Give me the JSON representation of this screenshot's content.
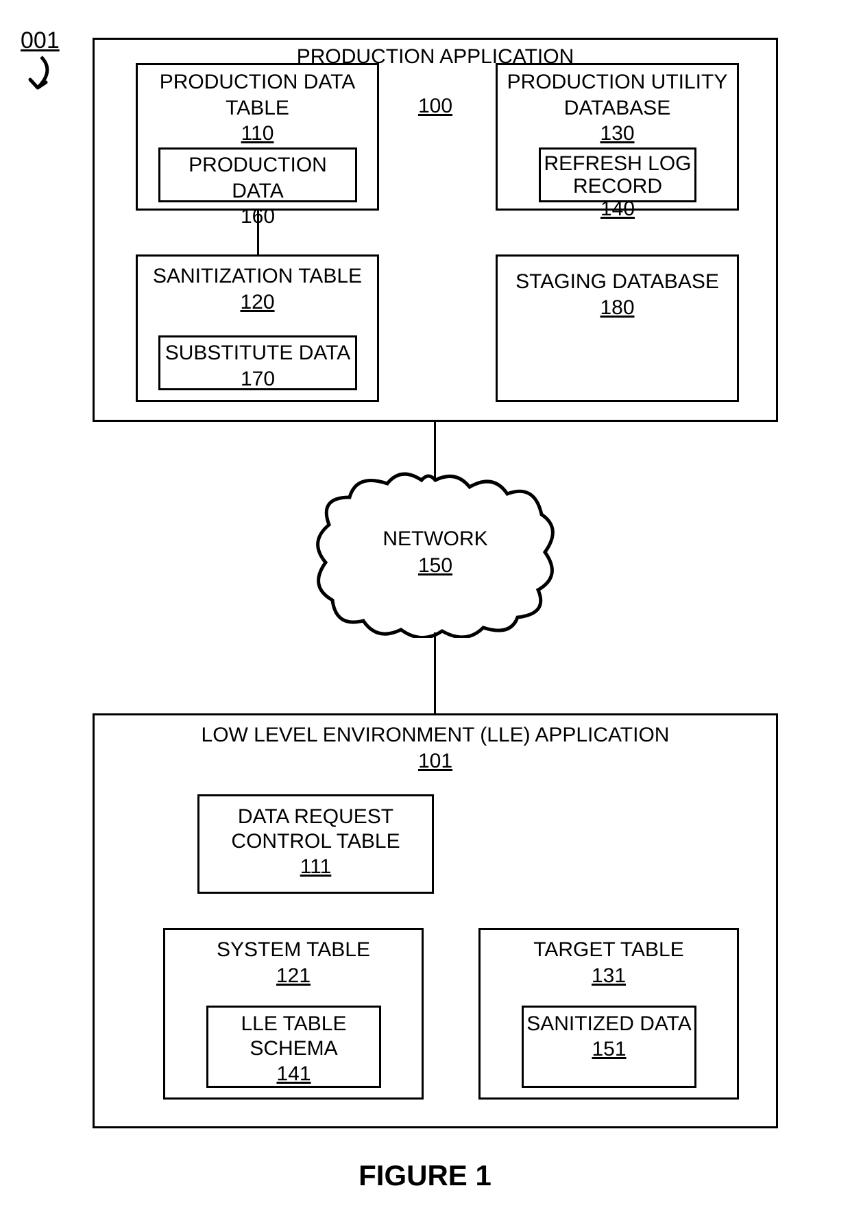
{
  "figure_ref": "001",
  "figure_caption": "FIGURE 1",
  "production_app": {
    "title": "PRODUCTION APPLICATION",
    "ref": "100",
    "production_data_table": {
      "title": "PRODUCTION DATA TABLE",
      "ref": "110",
      "inner": {
        "title": "PRODUCTION DATA",
        "ref": "160"
      }
    },
    "production_utility_db": {
      "title": "PRODUCTION UTILITY DATABASE",
      "ref": "130",
      "inner": {
        "title": "REFRESH LOG RECORD",
        "ref": "140"
      }
    },
    "sanitization_table": {
      "title": "SANITIZATION TABLE",
      "ref": "120",
      "inner": {
        "title": "SUBSTITUTE DATA",
        "ref": "170"
      }
    },
    "staging_db": {
      "title": "STAGING DATABASE",
      "ref": "180"
    }
  },
  "network": {
    "title": "NETWORK",
    "ref": "150"
  },
  "lle_app": {
    "title": "LOW LEVEL ENVIRONMENT (LLE) APPLICATION",
    "ref": "101",
    "data_request_control_table": {
      "title": "DATA REQUEST CONTROL TABLE",
      "ref": "111"
    },
    "system_table": {
      "title": "SYSTEM TABLE",
      "ref": "121",
      "inner": {
        "title": "LLE TABLE SCHEMA",
        "ref": "141"
      }
    },
    "target_table": {
      "title": "TARGET TABLE",
      "ref": "131",
      "inner": {
        "title": "SANITIZED DATA",
        "ref": "151"
      }
    }
  }
}
